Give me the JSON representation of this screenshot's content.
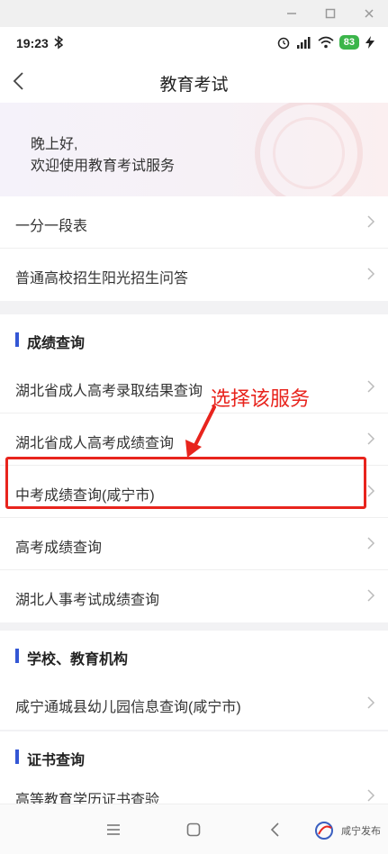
{
  "window": {
    "minimize_icon": "minimize-icon",
    "maximize_icon": "maximize-icon",
    "close_icon": "close-icon"
  },
  "status_bar": {
    "time": "19:23",
    "battery": "83"
  },
  "navbar": {
    "title": "教育考试"
  },
  "greeting": {
    "line1": "晚上好,",
    "line2": "欢迎使用教育考试服务"
  },
  "top_items": [
    {
      "label": "一分一段表"
    },
    {
      "label": "普通高校招生阳光招生问答"
    }
  ],
  "section_score": {
    "title": "成绩查询",
    "items": [
      {
        "label": "湖北省成人高考录取结果查询"
      },
      {
        "label": "湖北省成人高考成绩查询"
      },
      {
        "label": "中考成绩查询(咸宁市)"
      },
      {
        "label": "高考成绩查询"
      },
      {
        "label": "湖北人事考试成绩查询"
      }
    ]
  },
  "section_school": {
    "title": "学校、教育机构",
    "items": [
      {
        "label": "咸宁通城县幼儿园信息查询(咸宁市)"
      }
    ]
  },
  "section_cert": {
    "title": "证书查询",
    "items": [
      {
        "label": "高等教育学历证书查验"
      }
    ]
  },
  "annotation": {
    "text": "选择该服务",
    "color": "#e8241d"
  },
  "watermark": {
    "text": "咸宁发布"
  },
  "colors": {
    "accent": "#3457d5",
    "annotation": "#e8241d",
    "battery": "#3bb54a"
  }
}
